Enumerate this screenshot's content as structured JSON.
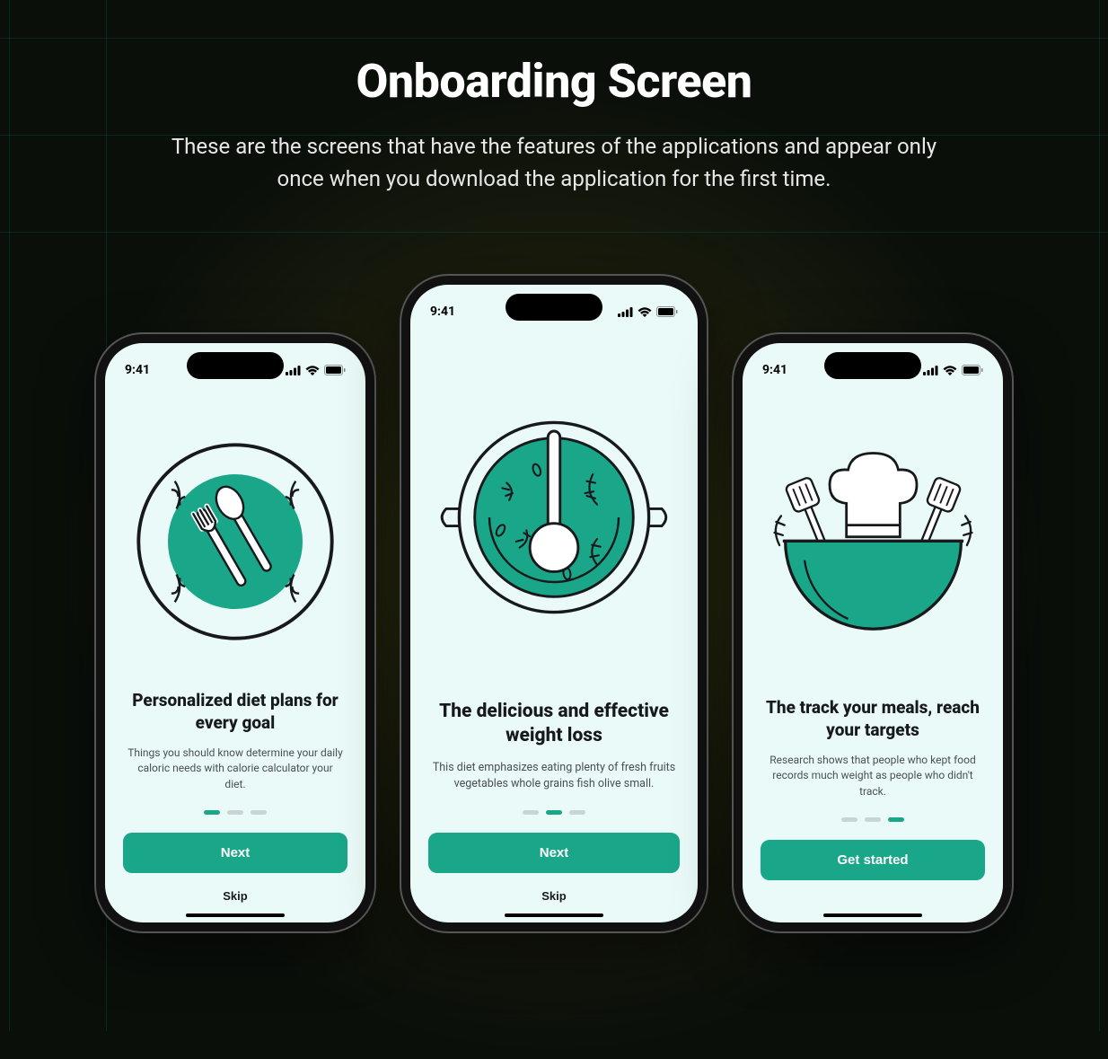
{
  "page": {
    "title": "Onboarding Screen",
    "subtitle": "These are the screens that have the features of the applications and appear only once when you download the application for the first time."
  },
  "status_time": "9:41",
  "colors": {
    "accent": "#1aa688",
    "screen_bg": "#eafaf8"
  },
  "screens": [
    {
      "title": "Personalized diet plans for every goal",
      "description": "Things you should know determine your daily caloric needs with calorie calculator your diet.",
      "button": "Next",
      "secondary": "Skip",
      "active_dot": 0,
      "illustration": "plate-utensils"
    },
    {
      "title": "The delicious and effective weight loss",
      "description": "This diet emphasizes eating plenty of fresh fruits vegetables whole grains fish olive small.",
      "button": "Next",
      "secondary": "Skip",
      "active_dot": 1,
      "illustration": "soup-pot"
    },
    {
      "title": "The track your meals, reach your targets",
      "description": "Research shows that people who kept food records much weight as people who didn't track.",
      "button": "Get started",
      "secondary": "",
      "active_dot": 2,
      "illustration": "chef-bowl"
    }
  ]
}
